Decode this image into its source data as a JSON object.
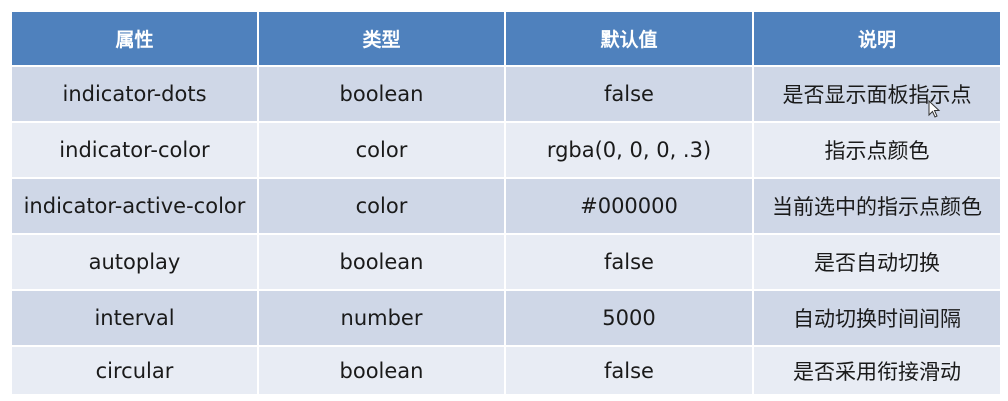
{
  "table": {
    "headers": [
      "属性",
      "类型",
      "默认值",
      "说明"
    ],
    "rows": [
      [
        "indicator-dots",
        "boolean",
        "false",
        "是否显示面板指示点"
      ],
      [
        "indicator-color",
        "color",
        "rgba(0, 0, 0, .3)",
        "指示点颜色"
      ],
      [
        "indicator-active-color",
        "color",
        "#000000",
        "当前选中的指示点颜色"
      ],
      [
        "autoplay",
        "boolean",
        "false",
        "是否自动切换"
      ],
      [
        "interval",
        "number",
        "5000",
        "自动切换时间间隔"
      ],
      [
        "circular",
        "boolean",
        "false",
        "是否采用衔接滑动"
      ]
    ]
  },
  "colors": {
    "header_bg": "#4f81bd",
    "row_odd_bg": "#cfd7e7",
    "row_even_bg": "#e8ecf4"
  },
  "icons": {
    "cursor": "mouse-pointer-icon"
  }
}
